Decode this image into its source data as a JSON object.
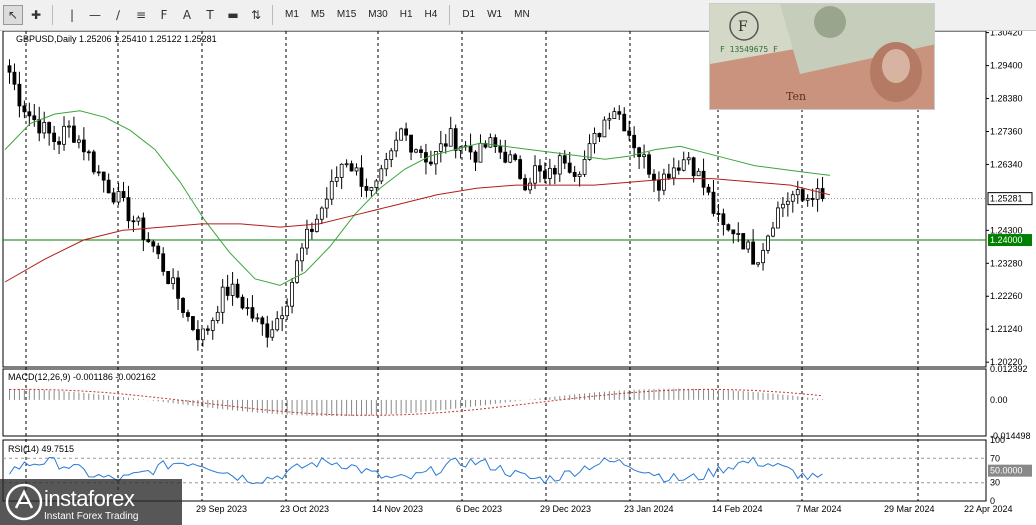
{
  "toolbar": {
    "icons": [
      "cursor-icon",
      "crosshair-icon",
      "vertical-line-icon",
      "horizontal-line-icon",
      "trendline-icon",
      "channel-icon",
      "fibonacci-icon",
      "text-icon",
      "label-icon",
      "rectangle-icon",
      "arrows-icon"
    ],
    "timeframes": [
      "M1",
      "M5",
      "M15",
      "M30",
      "H1",
      "H4",
      "D1",
      "W1",
      "MN"
    ]
  },
  "header": "GBPUSD,Daily  1.25206 1.25410 1.25122 1.25281",
  "macd_label": "MACD(12,26,9) -0.001186 -0.002162",
  "rsi_label": "RSI(14) 49.7515",
  "logo": {
    "main": "instaforex",
    "sub": "Instant Forex Trading"
  },
  "photo": {
    "note_code": "F 13549675 F",
    "ten_text": "Ten"
  },
  "colors": {
    "bull_candle": "#000000",
    "bear_candle": "#000000",
    "ma_fast": "#3aa63a",
    "ma_slow": "#b31c1c",
    "level_line": "#008000",
    "macd_signal": "#c83232",
    "rsi_line": "#2a7ad5",
    "price_tag_bg": "#ffffff",
    "level_tag_bg": "#008000"
  },
  "chart_data": [
    {
      "type": "candlestick",
      "title": "GBPUSD,Daily",
      "ohlc_current": {
        "open": 1.25206,
        "high": 1.2541,
        "low": 1.25122,
        "close": 1.25281
      },
      "x_tick_labels": [
        "29 Sep 2023",
        "23 Oct 2023",
        "14 Nov 2023",
        "6 Dec 2023",
        "29 Dec 2023",
        "23 Jan 2024",
        "14 Feb 2024",
        "7 Mar 2024",
        "29 Mar 2024",
        "22 Apr 2024"
      ],
      "y_tick_labels": [
        "1.30420",
        "1.29400",
        "1.28380",
        "1.27360",
        "1.26340",
        "1.24300",
        "1.23280",
        "1.22260",
        "1.21240",
        "1.20220"
      ],
      "ylim": [
        1.2007,
        1.3047
      ],
      "price_tags": {
        "current": "1.25281",
        "level": "1.24000"
      },
      "horizontal_level": 1.24,
      "close_path": [
        1.292,
        1.284,
        1.279,
        1.276,
        1.273,
        1.27,
        1.275,
        1.272,
        1.268,
        1.262,
        1.258,
        1.254,
        1.25,
        1.246,
        1.242,
        1.238,
        1.232,
        1.226,
        1.22,
        1.214,
        1.21,
        1.214,
        1.222,
        1.225,
        1.222,
        1.218,
        1.214,
        1.212,
        1.216,
        1.222,
        1.232,
        1.24,
        1.246,
        1.252,
        1.258,
        1.266,
        1.262,
        1.258,
        1.254,
        1.26,
        1.266,
        1.274,
        1.27,
        1.268,
        1.264,
        1.268,
        1.272,
        1.27,
        1.268,
        1.266,
        1.27,
        1.268,
        1.266,
        1.262,
        1.258,
        1.262,
        1.258,
        1.262,
        1.266,
        1.262,
        1.264,
        1.27,
        1.276,
        1.282,
        1.278,
        1.272,
        1.266,
        1.262,
        1.258,
        1.262,
        1.264,
        1.266,
        1.26,
        1.254,
        1.246,
        1.242,
        1.244,
        1.238,
        1.234,
        1.24,
        1.248,
        1.252,
        1.254,
        1.252,
        1.255,
        1.252
      ],
      "ma_fast_path": [
        1.268,
        1.276,
        1.279,
        1.28,
        1.278,
        1.274,
        1.268,
        1.258,
        1.246,
        1.236,
        1.228,
        1.226,
        1.23,
        1.238,
        1.248,
        1.256,
        1.262,
        1.266,
        1.268,
        1.27,
        1.269,
        1.268,
        1.267,
        1.266,
        1.265,
        1.266,
        1.268,
        1.269,
        1.267,
        1.265,
        1.263,
        1.262,
        1.261,
        1.26
      ],
      "ma_slow_path": [
        1.227,
        1.234,
        1.24,
        1.243,
        1.244,
        1.245,
        1.245,
        1.244,
        1.245,
        1.248,
        1.251,
        1.254,
        1.256,
        1.257,
        1.257,
        1.257,
        1.258,
        1.259,
        1.259,
        1.258,
        1.257,
        1.254
      ]
    },
    {
      "type": "bar",
      "title": "MACD(12,26,9)",
      "values_label": [
        "-0.001186",
        "-0.002162"
      ],
      "y_tick_labels": [
        "0.012392",
        "0.00",
        "-0.014498"
      ],
      "ylim": [
        -0.0145,
        0.0124
      ]
    },
    {
      "type": "line",
      "title": "RSI(14)",
      "value": 49.7515,
      "y_tick_labels": [
        "100",
        "70",
        "50",
        "30",
        "0"
      ],
      "current_tag": "50.0000",
      "ylim": [
        0,
        100
      ]
    }
  ]
}
